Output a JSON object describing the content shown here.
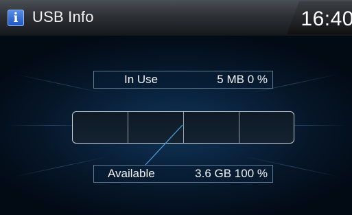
{
  "header": {
    "title": "USB Info",
    "info_icon_glyph": "i",
    "clock": "16:40"
  },
  "usage": {
    "in_use": {
      "label": "In Use",
      "value": "5 MB 0 %",
      "fraction": 0.0
    },
    "available": {
      "label": "Available",
      "value": "3.6 GB 100 %",
      "fraction": 1.0
    },
    "bar_segments": 4
  },
  "colors": {
    "background": "#061628",
    "title_bar": "#2d3136",
    "text": "#f2f2f2",
    "box_border": "#5f7c93",
    "pointer_line": "#4aa3e0"
  },
  "icons": {
    "info": "info-icon"
  }
}
